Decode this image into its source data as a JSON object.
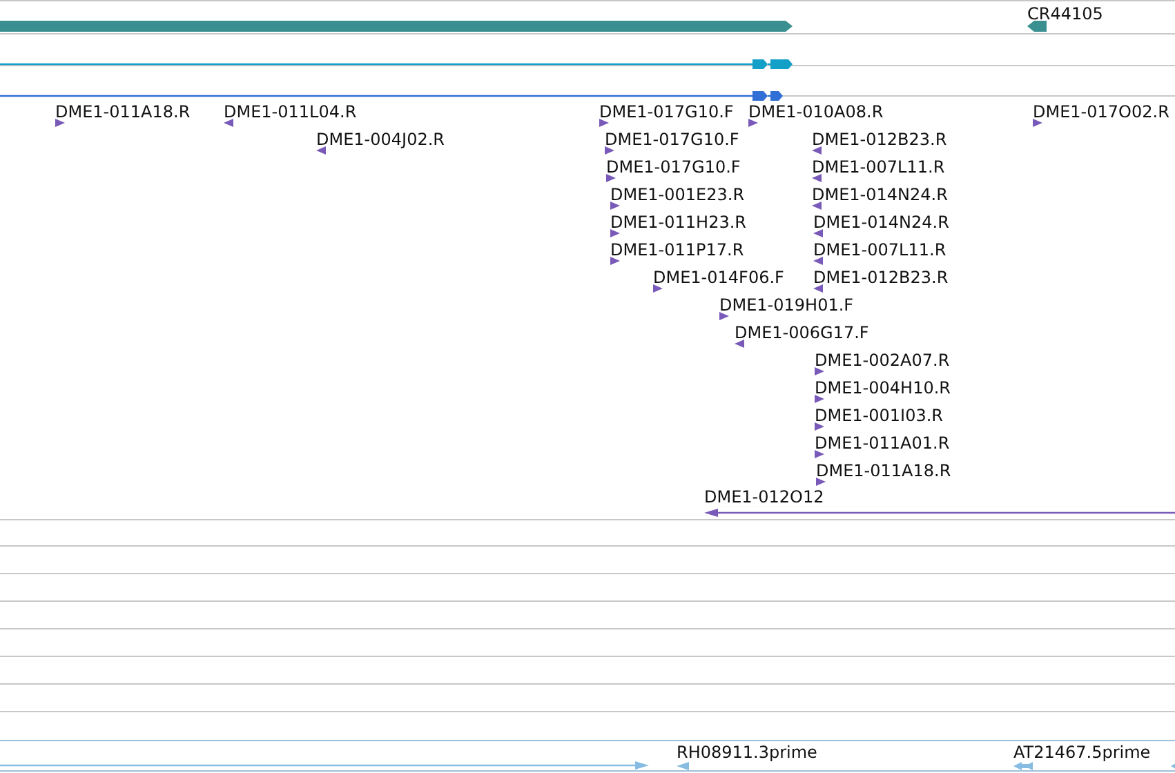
{
  "tracks": [
    {
      "kind": "gene",
      "features": [
        {
          "kind": "bar",
          "reverse": false
        },
        {
          "kind": "bar",
          "reverse": true,
          "label": "CR44105"
        }
      ]
    },
    {
      "kind": "transcript",
      "features": [
        {
          "kind": "transcript",
          "reverse": false
        }
      ]
    },
    {
      "kind": "protein",
      "features": [
        {
          "kind": "transcript",
          "reverse": false
        }
      ]
    },
    {
      "kind": "primer",
      "features": [
        {
          "kind": "marker",
          "reverse": false,
          "label": "DME1-011A18.R"
        },
        {
          "kind": "marker",
          "reverse": true,
          "label": "DME1-011L04.R"
        },
        {
          "kind": "marker",
          "reverse": false,
          "label": "DME1-017G10.F"
        },
        {
          "kind": "marker",
          "reverse": false,
          "label": "DME1-010A08.R"
        },
        {
          "kind": "marker",
          "reverse": false,
          "label": "DME1-017O02.R"
        },
        {
          "kind": "marker",
          "reverse": true,
          "label": "DME1-004J02.R"
        },
        {
          "kind": "marker",
          "reverse": false,
          "label": "DME1-017G10.F"
        },
        {
          "kind": "marker",
          "reverse": true,
          "label": "DME1-012B23.R"
        },
        {
          "kind": "marker",
          "reverse": false,
          "label": "DME1-017G10.F"
        },
        {
          "kind": "marker",
          "reverse": true,
          "label": "DME1-007L11.R"
        },
        {
          "kind": "marker",
          "reverse": false,
          "label": "DME1-001E23.R"
        },
        {
          "kind": "marker",
          "reverse": true,
          "label": "DME1-014N24.R"
        },
        {
          "kind": "marker",
          "reverse": false,
          "label": "DME1-011H23.R"
        },
        {
          "kind": "marker",
          "reverse": true,
          "label": "DME1-014N24.R"
        },
        {
          "kind": "marker",
          "reverse": false,
          "label": "DME1-011P17.R"
        },
        {
          "kind": "marker",
          "reverse": true,
          "label": "DME1-007L11.R"
        },
        {
          "kind": "marker",
          "reverse": false,
          "label": "DME1-014F06.F"
        },
        {
          "kind": "marker",
          "reverse": true,
          "label": "DME1-012B23.R"
        },
        {
          "kind": "marker",
          "reverse": false,
          "label": "DME1-019H01.F"
        },
        {
          "kind": "marker",
          "reverse": true,
          "label": "DME1-006G17.F"
        },
        {
          "kind": "marker",
          "reverse": false,
          "label": "DME1-002A07.R"
        },
        {
          "kind": "marker",
          "reverse": false,
          "label": "DME1-004H10.R"
        },
        {
          "kind": "marker",
          "reverse": false,
          "label": "DME1-001I03.R"
        },
        {
          "kind": "marker",
          "reverse": false,
          "label": "DME1-011A01.R"
        },
        {
          "kind": "marker",
          "reverse": false,
          "label": "DME1-011A18.R"
        },
        {
          "kind": "span",
          "reverse": true,
          "label": "DME1-012O12"
        }
      ]
    },
    {
      "kind": "empty"
    },
    {
      "kind": "empty"
    },
    {
      "kind": "empty"
    },
    {
      "kind": "empty"
    },
    {
      "kind": "empty"
    },
    {
      "kind": "empty"
    },
    {
      "kind": "empty"
    },
    {
      "kind": "empty"
    },
    {
      "kind": "est",
      "features": [
        {
          "kind": "span",
          "reverse": false
        },
        {
          "kind": "marker",
          "reverse": true,
          "label": "RH08911.3prime"
        },
        {
          "kind": "marker",
          "reverse": true,
          "label": "AT21467.5prime"
        },
        {
          "kind": "marker",
          "reverse": true
        }
      ]
    }
  ]
}
